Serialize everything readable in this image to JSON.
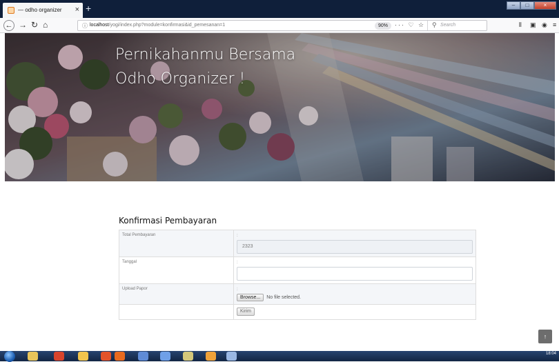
{
  "browser": {
    "tab_title": "— odho organizer",
    "tab_close": "×",
    "new_tab": "+",
    "window_buttons": [
      "–",
      "□",
      "×"
    ],
    "url_host": "localhost",
    "url_path": "/yogi/index.php?module=konfirmasi&id_pemesanan=1",
    "zoom": "90%",
    "url_actions": "··· ♡ ☆",
    "search_placeholder": "Search"
  },
  "hero": {
    "title_line1": "Pernikahanmu Bersama",
    "title_line2": "Odho Organizer !"
  },
  "form": {
    "heading": "Konfirmasi Pembayaran",
    "colon": ":",
    "rows": [
      {
        "label": "Total Pembayaran",
        "value": "2323"
      },
      {
        "label": "Tanggal",
        "value": ""
      },
      {
        "label": "Upload Papor",
        "value": ""
      }
    ],
    "browse_label": "Browse...",
    "file_status": "No file selected.",
    "submit_label": "Kirim"
  },
  "scroll_top_icon": "↑",
  "taskbar": {
    "time": "18:04"
  },
  "colors": {
    "tabbar": "#0f1f3a",
    "taskbar": "#1a3157",
    "table_border": "#dddddd"
  }
}
